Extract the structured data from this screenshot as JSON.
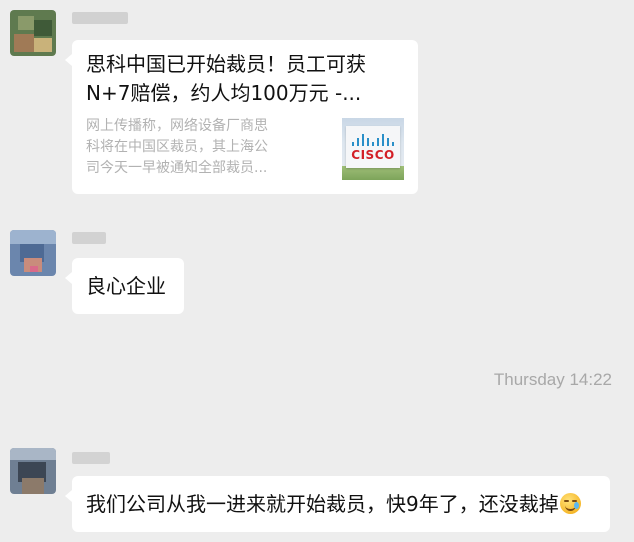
{
  "messages": [
    {
      "type": "link_card",
      "title": "思科中国已开始裁员！员工可获\nN+7赔偿，约人均100万元 -...",
      "description": "网上传播称，网络设备厂商思\n科将在中国区裁员，其上海公\n司今天一早被通知全部裁员...",
      "thumbnail_text": "CISCO"
    },
    {
      "type": "text",
      "text": "良心企业"
    },
    {
      "type": "text",
      "text": "我们公司从我一进来就开始裁员，快9年了，还没裁掉",
      "emoji": "crying-laughing-emoji"
    }
  ],
  "timestamp": "Thursday 14:22",
  "colors": {
    "background": "#ededed",
    "bubble": "#ffffff",
    "text": "#111111",
    "muted_text": "#b2b2b2",
    "timestamp": "#a8a8a8",
    "cisco_red": "#d31f26",
    "cisco_blue": "#2a8fc8"
  }
}
